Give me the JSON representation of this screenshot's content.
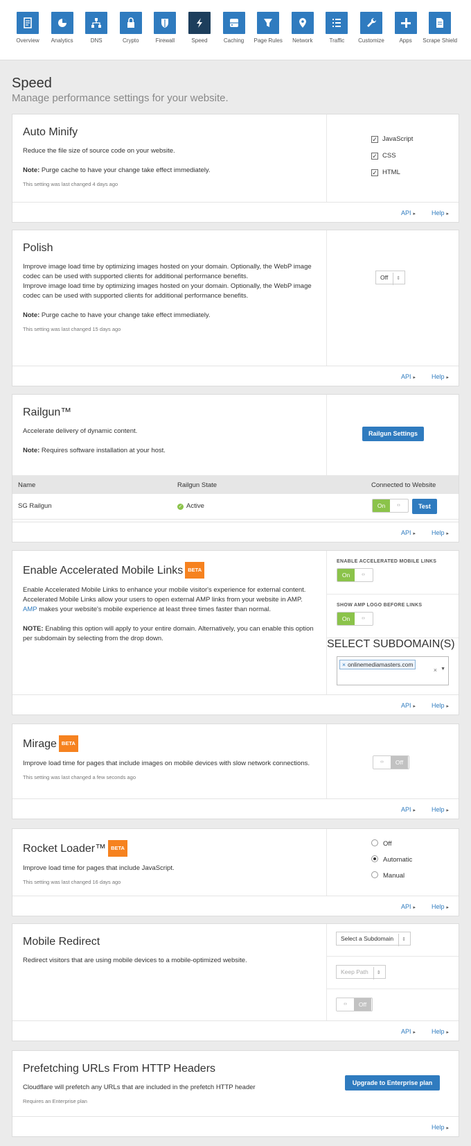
{
  "nav": [
    {
      "label": "Overview",
      "icon": "overview-icon"
    },
    {
      "label": "Analytics",
      "icon": "analytics-icon"
    },
    {
      "label": "DNS",
      "icon": "dns-icon"
    },
    {
      "label": "Crypto",
      "icon": "lock-icon"
    },
    {
      "label": "Firewall",
      "icon": "shield-icon"
    },
    {
      "label": "Speed",
      "icon": "lightning-icon"
    },
    {
      "label": "Caching",
      "icon": "caching-icon"
    },
    {
      "label": "Page Rules",
      "icon": "filter-icon"
    },
    {
      "label": "Network",
      "icon": "location-pin-icon"
    },
    {
      "label": "Traffic",
      "icon": "list-icon"
    },
    {
      "label": "Customize",
      "icon": "wrench-icon"
    },
    {
      "label": "Apps",
      "icon": "plus-icon"
    },
    {
      "label": "Scrape Shield",
      "icon": "document-icon"
    }
  ],
  "active_nav": "Speed",
  "page": {
    "title": "Speed",
    "subtitle": "Manage performance settings for your website."
  },
  "footer_links": {
    "api": "API",
    "help": "Help"
  },
  "auto_minify": {
    "title": "Auto Minify",
    "desc": "Reduce the file size of source code on your website.",
    "note_label": "Note:",
    "note": "Purge cache to have your change take effect immediately.",
    "changed": "This setting was last changed 4 days ago",
    "options": [
      {
        "label": "JavaScript",
        "checked": true
      },
      {
        "label": "CSS",
        "checked": true
      },
      {
        "label": "HTML",
        "checked": true
      }
    ]
  },
  "polish": {
    "title": "Polish",
    "desc": "Improve image load time by optimizing images hosted on your domain. Optionally, the WebP image codec can be used with supported clients for additional performance benefits.",
    "desc2": "Improve image load time by optimizing images hosted on your domain. Optionally, the WebP image codec can be used with supported clients for additional performance benefits.",
    "note_label": "Note:",
    "note": "Purge cache to have your change take effect immediately.",
    "changed": "This setting was last changed 15 days ago",
    "select_value": "Off"
  },
  "railgun": {
    "title": "Railgun™",
    "desc": "Accelerate delivery of dynamic content.",
    "note_label": "Note:",
    "note": "Requires software installation at your host.",
    "button": "Railgun Settings",
    "columns": [
      "Name",
      "Railgun State",
      "Connected to Website"
    ],
    "row": {
      "name": "SG Railgun",
      "state": "Active",
      "toggle": "On",
      "test": "Test"
    }
  },
  "amp": {
    "title": "Enable Accelerated Mobile Links",
    "beta": "BETA",
    "desc_part1": "Enable Accelerated Mobile Links to enhance your mobile visitor's experience for external content. Accelerated Mobile Links allow your users to open external AMP links from your website in AMP.",
    "amp_link": "AMP",
    "desc_part2": "makes your website's mobile experience at least three times faster than normal.",
    "note_label": "NOTE:",
    "note": "Enabling this option will apply to your entire domain. Alternatively, you can enable this option per subdomain by selecting from the drop down.",
    "enable_caption": "ENABLE ACCELERATED MOBILE LINKS",
    "enable_toggle": "On",
    "logo_caption": "SHOW AMP LOGO BEFORE LINKS",
    "logo_toggle": "On",
    "subdomain_caption": "SELECT SUBDOMAIN(S)",
    "subdomain_tag": "onlinemediamasters.com"
  },
  "mirage": {
    "title": "Mirage",
    "beta": "BETA",
    "desc": "Improve load time for pages that include images on mobile devices with slow network connections.",
    "changed": "This setting was last changed a few seconds ago",
    "toggle": "Off"
  },
  "rocket": {
    "title": "Rocket Loader™",
    "beta": "BETA",
    "desc": "Improve load time for pages that include JavaScript.",
    "changed": "This setting was last changed 16 days ago",
    "options": [
      {
        "label": "Off",
        "checked": false
      },
      {
        "label": "Automatic",
        "checked": true
      },
      {
        "label": "Manual",
        "checked": false
      }
    ]
  },
  "mobile_redirect": {
    "title": "Mobile Redirect",
    "desc": "Redirect visitors that are using mobile devices to a mobile-optimized website.",
    "subdomain_select": "Select a Subdomain",
    "keep_path": "Keep Path",
    "toggle": "Off"
  },
  "prefetch": {
    "title": "Prefetching URLs From HTTP Headers",
    "desc": "Cloudflare will prefetch any URLs that are included in the prefetch HTTP header",
    "requires": "Requires an Enterprise plan",
    "button": "Upgrade to Enterprise plan"
  }
}
